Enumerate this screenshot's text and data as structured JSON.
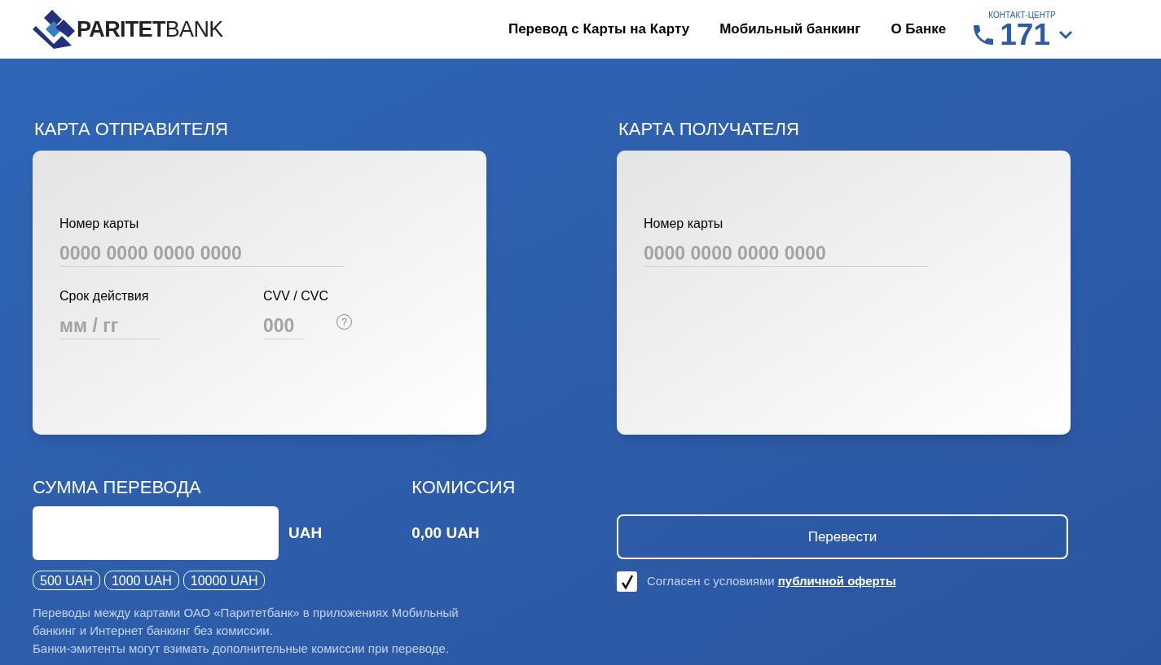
{
  "header": {
    "logo": "**PARITET**BANK",
    "nav": [
      "Перевод с Карты на Карту",
      "Мобильный банкинг",
      "О Банке"
    ],
    "contact": {
      "label": "КОНТАКТ-ЦЕНТР",
      "number": "171"
    }
  },
  "sender": {
    "title": "КАРТА ОТПРАВИТЕЛЯ",
    "card_number": {
      "label": "Номер карты",
      "placeholder": "0000 0000 0000 0000"
    },
    "expiry": {
      "label": "Срок действия",
      "placeholder": "мм / гг"
    },
    "cvv": {
      "label": "CVV / CVC",
      "placeholder": "000",
      "help": "?"
    }
  },
  "recipient": {
    "title": "КАРТА ПОЛУЧАТЕЛЯ",
    "card_number": {
      "label": "Номер карты",
      "placeholder": "0000 0000 0000 0000"
    }
  },
  "amount": {
    "title": "СУММА ПЕРЕВОДА",
    "currency": "UAH",
    "presets": [
      "500 UAH",
      "1000 UAH",
      "10000 UAH"
    ]
  },
  "commission": {
    "title": "КОМИССИЯ",
    "value": "0,00 UAH"
  },
  "note": [
    "Переводы между картами ОАО «Паритетбанк» в приложениях Мобильный банкинг и Интернет банкинг без комиссии.",
    "Банки-эмитенты могут взимать дополнительные комиссии при переводе."
  ],
  "submit": "Перевести",
  "agreement": {
    "checked": true,
    "text": "Согласен с условиями ",
    "link": "публичной оферты"
  }
}
